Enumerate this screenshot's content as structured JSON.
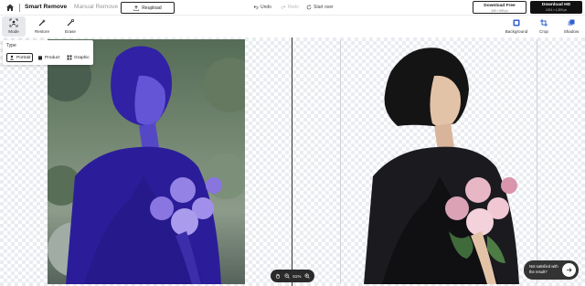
{
  "header": {
    "mode_tabs": [
      {
        "label": "Smart Remove"
      },
      {
        "label": "Manual Remove"
      }
    ],
    "reupload_label": "Reupload",
    "history": {
      "undo": "Undo",
      "redo": "Redo",
      "start_over": "Start over"
    },
    "download_free": {
      "title": "Download Free",
      "subtitle": "449 × 559 px"
    },
    "download_hd": {
      "title": "Download HD",
      "subtitle": "1024 × 1,300 px"
    }
  },
  "toolbar": {
    "left": [
      {
        "label": "Mode"
      },
      {
        "label": "Restore"
      },
      {
        "label": "Erase"
      }
    ],
    "right": [
      {
        "label": "Background"
      },
      {
        "label": "Crop"
      },
      {
        "label": "Shadow"
      }
    ]
  },
  "type_panel": {
    "title": "Type",
    "options": [
      {
        "label": "Portrait"
      },
      {
        "label": "Product"
      },
      {
        "label": "Graphic"
      }
    ],
    "selected": "Portrait"
  },
  "zoom": {
    "level": "51%"
  },
  "feedback": {
    "line1": "Not satisfied with",
    "line2": "the result?"
  },
  "colors": {
    "mask_overlay": "#3d2bd6",
    "accent": "#111111",
    "checker": "#e9ecf0"
  }
}
